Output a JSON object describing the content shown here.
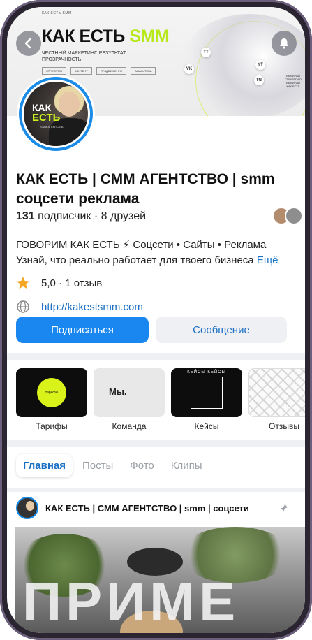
{
  "cover": {
    "brand_small": "КАК ЕСТЬ SMM",
    "brand_main": "КАК ЕСТЬ",
    "brand_accent": "SMM",
    "tagline": "ЧЕСТНЫЙ МАРКЕТИНГ. РЕЗУЛЬТАТ. ПРОЗРАЧНОСТЬ.",
    "chips": [
      "СТРАТЕГИЯ",
      "КОНТЕНТ",
      "ПРОДВИЖЕНИЕ",
      "АНАЛИТИКА"
    ],
    "social": [
      "VK",
      "TT",
      "YT",
      "TG"
    ],
    "side_text": "ВЫБИРАЙ СТРАТЕГИЮ ВЫБИРАЙ КАК ЕСТЬ",
    "accent_color": "#b7e81a"
  },
  "avatar": {
    "line1": "КАК",
    "line2": "ЕСТЬ",
    "line3": "SMM АГЕНТСТВО"
  },
  "profile": {
    "name": "КАК ЕСТЬ | СММ АГЕНТСТВО | smm соцсети реклама",
    "subscribers": "131",
    "subscribers_label": "подписчик",
    "friends": "· 8 друзей",
    "bio_line1": "ГОВОРИМ КАК ЕСТЬ ⚡ Соцсети • Сайты • Реклама",
    "bio_line2": "Узнай, что реально работает для твоего бизнеса",
    "bio_more": "Ещё",
    "rating": "5,0 · 1 отзыв",
    "website": "http://kakestsmm.com"
  },
  "buttons": {
    "subscribe": "Подписаться",
    "message": "Сообщение"
  },
  "highlights": [
    {
      "label": "Тарифы",
      "tile_text": "тарифы"
    },
    {
      "label": "Команда",
      "tile_text": "Мы."
    },
    {
      "label": "Кейсы",
      "tile_text": "КЕЙСЫ КЕЙСЫ"
    },
    {
      "label": "Отзывы",
      "tile_text": ""
    }
  ],
  "tabs": [
    "Главная",
    "Посты",
    "Фото",
    "Клипы"
  ],
  "post": {
    "title": "КАК ЕСТЬ | СММ АГЕНТСТВО | smm | соцсети",
    "image_text": "ПРИМЕ"
  }
}
